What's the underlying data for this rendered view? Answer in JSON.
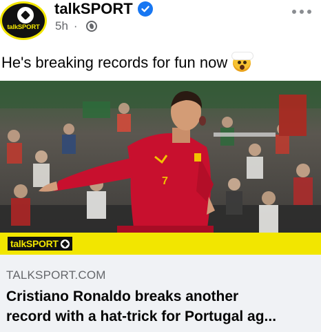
{
  "post": {
    "page_name": "talkSPORT",
    "avatar_text": "talkSPORT",
    "time": "5h",
    "dot": "·",
    "caption": "He's breaking records for fun now"
  },
  "banner": {
    "logo_text": "talkSPORT"
  },
  "link": {
    "domain": "TALKSPORT.COM",
    "headline_line1": "Cristiano Ronaldo breaks another",
    "headline_line2": "record with a hat-trick for Portugal ag..."
  },
  "colors": {
    "brand_yellow": "#f2e600",
    "verified_blue": "#1877f2",
    "shirt_red": "#c8102e"
  },
  "icons": {
    "verified": "verified-badge-icon",
    "privacy": "globe-icon",
    "more": "more-options-icon",
    "emoji": "exploding-head-emoji"
  }
}
